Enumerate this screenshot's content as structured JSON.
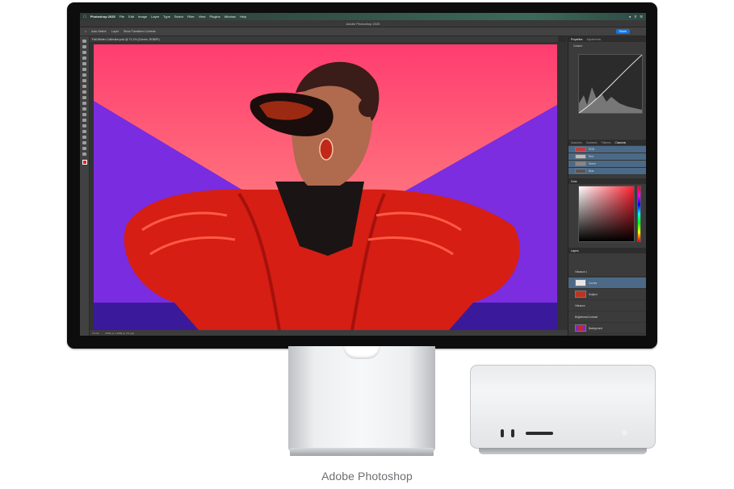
{
  "caption": "Adobe Photoshop",
  "menubar": {
    "app": "Photoshop 2025",
    "items": [
      "File",
      "Edit",
      "Image",
      "Layer",
      "Type",
      "Select",
      "Filter",
      "View",
      "Plugins",
      "Window",
      "Help"
    ]
  },
  "photoshop": {
    "title": "Adobe Photoshop 2025",
    "document_tab": "Fall-Winter-Collection.psd @ 71.1% (Curves, RGB/8*)",
    "options": [
      "Auto-Select:",
      "Layer",
      "Show Transform Controls"
    ],
    "share_label": "Share",
    "status": [
      "71.1%",
      "6000 px x 4000 px (72 ppi)"
    ],
    "panel_tabs_top": [
      "Properties",
      "Adjustments"
    ],
    "panel_tabs_mid": [
      "Swatches",
      "Gradients",
      "Patterns",
      "Channels"
    ],
    "panel_tab_color": "Color",
    "panel_tab_layers": "Layers",
    "curves_preset": "Custom",
    "channel_rows": [
      "RGB",
      "Red",
      "Green",
      "Blue"
    ],
    "layers": [
      "Vibrance 1",
      "Curves",
      "Subject",
      "Vibrance",
      "Brightness/Contrast",
      "Background"
    ],
    "accent": "#1473e6"
  }
}
